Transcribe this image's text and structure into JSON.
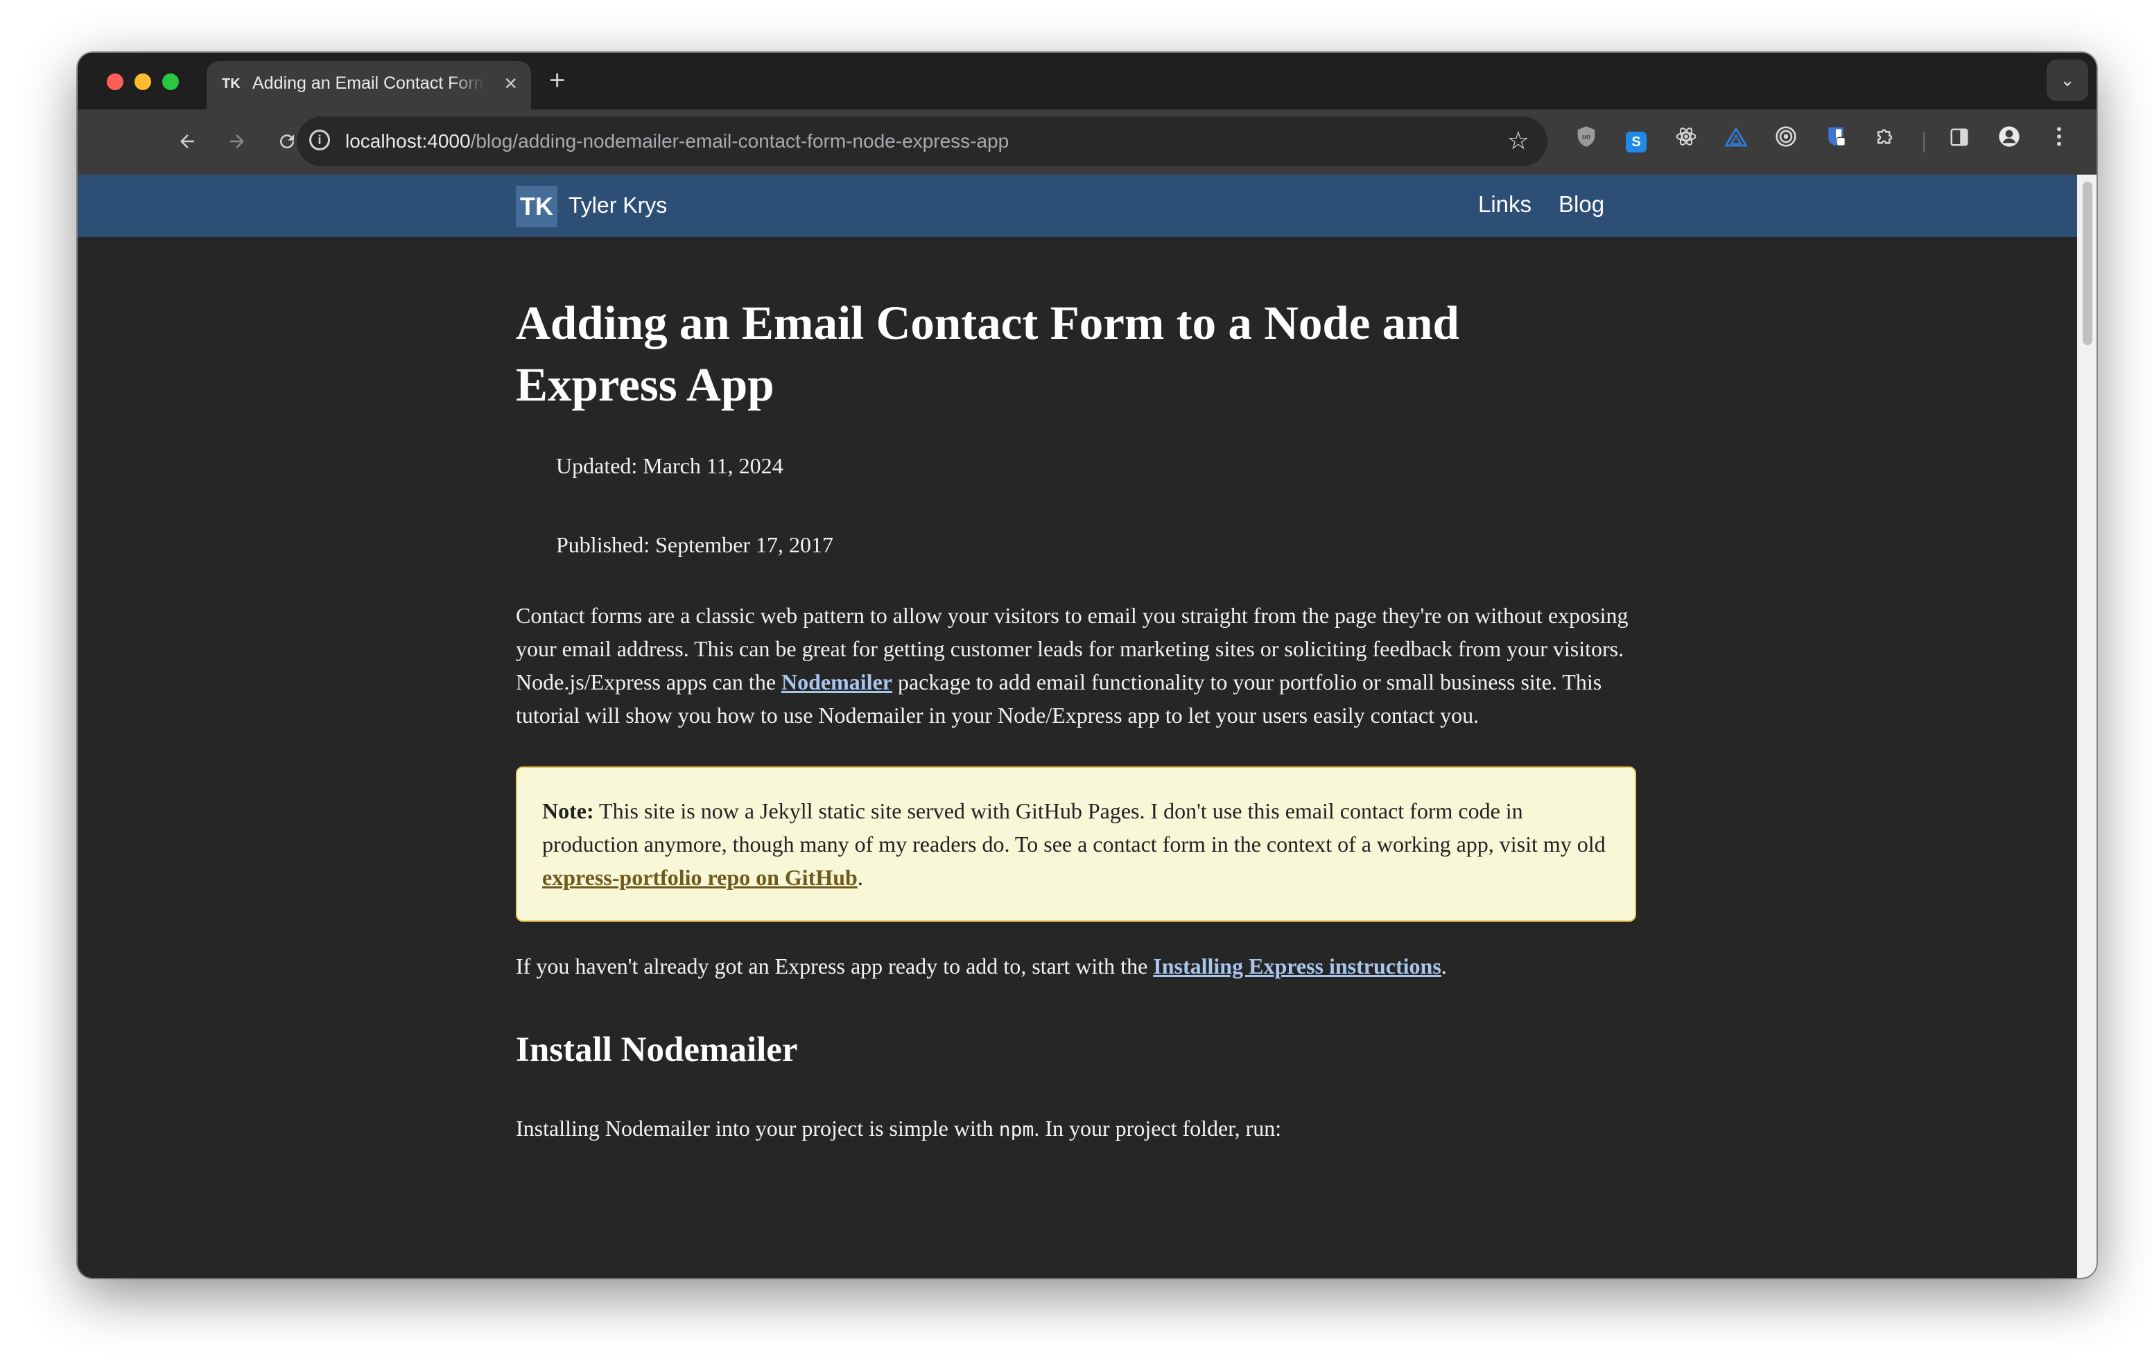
{
  "browser": {
    "tab": {
      "favicon": "TK",
      "title": "Adding an Email Contact Form to a Node and Express App"
    },
    "address": {
      "host": "localhost:4000",
      "path": "/blog/adding-nodemailer-email-contact-form-node-express-app"
    },
    "icons": {
      "back": "back-arrow-icon",
      "forward": "forward-arrow-icon",
      "reload": "reload-icon",
      "home": "home-icon",
      "info": "site-info-icon",
      "bookmark": "bookmark-star-icon",
      "new_tab": "plus-icon",
      "tab_close": "close-icon",
      "tab_menu": "chevron-down-icon",
      "extensions_menu": "puzzle-icon",
      "side_panel": "side-panel-icon",
      "profile": "profile-icon",
      "menu": "kebab-menu-icon"
    }
  },
  "site": {
    "logo": "TK",
    "name": "Tyler Krys",
    "nav": [
      "Links",
      "Blog"
    ]
  },
  "article": {
    "title": "Adding an Email Contact Form to a Node and Express App",
    "updated": "Updated: March 11, 2024",
    "published": "Published: September 17, 2017",
    "intro": {
      "before_link": "Contact forms are a classic web pattern to allow your visitors to email you straight from the page they're on without exposing your email address. This can be great for getting customer leads for marketing sites or soliciting feedback from your visitors. Node.js/Express apps can the ",
      "link": "Nodemailer",
      "after_link": " package to add email functionality to your portfolio or small business site. This tutorial will show you how to use Nodemailer in your Node/Express app to let your users easily contact you."
    },
    "note": {
      "label": "Note:",
      "text": " This site is now a Jekyll static site served with GitHub Pages. I don't use this email contact form code in production anymore, though many of my readers do. To see a contact form in the context of a working app, visit my old ",
      "link": "express-portfolio repo on GitHub",
      "end": "."
    },
    "express_line": {
      "before_link": "If you haven't already got an Express app ready to add to, start with the ",
      "link": "Installing Express instructions",
      "end": "."
    },
    "section_heading": "Install Nodemailer",
    "install_line": {
      "before": "Installing Nodemailer into your project is simple with ",
      "code": "npm",
      "after": ". In your project folder, run:"
    }
  },
  "colors": {
    "page_bg": "#262626",
    "nav_bg": "#2d4f76",
    "link": "#a9c6ee",
    "note_bg": "#f8f8d8",
    "note_border": "#e8c85a"
  }
}
